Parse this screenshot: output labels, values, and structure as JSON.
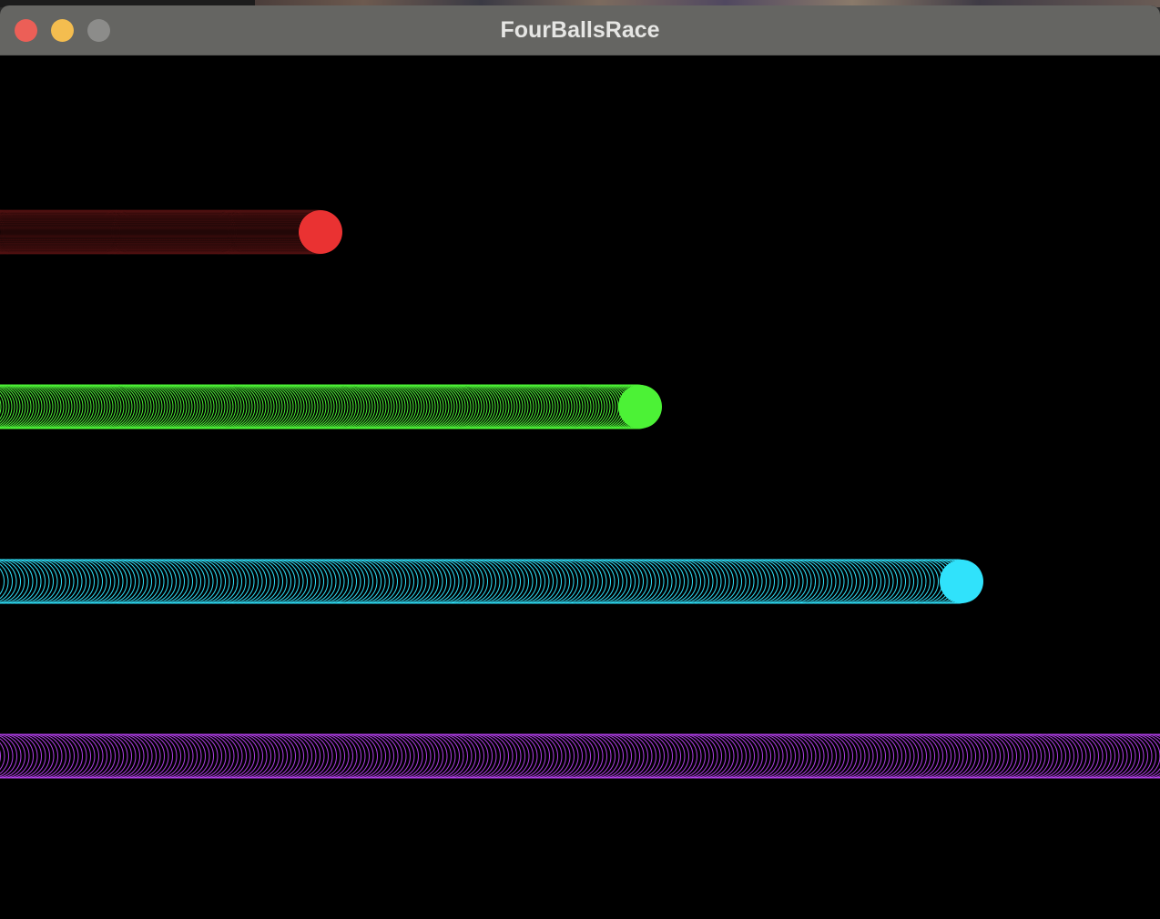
{
  "window": {
    "title": "FourBallsRace"
  },
  "race": {
    "balls": [
      {
        "name": "red",
        "color": "#ea3232",
        "trail_style": "faint",
        "progress": 0.276
      },
      {
        "name": "green",
        "color": "#4cf236",
        "trail_style": "dense",
        "progress": 0.552
      },
      {
        "name": "cyan",
        "color": "#30e2fb",
        "trail_style": "rings",
        "progress": 0.829
      },
      {
        "name": "purple",
        "color": "#b03ee6",
        "trail_style": "rings",
        "progress": 1.0
      }
    ]
  }
}
